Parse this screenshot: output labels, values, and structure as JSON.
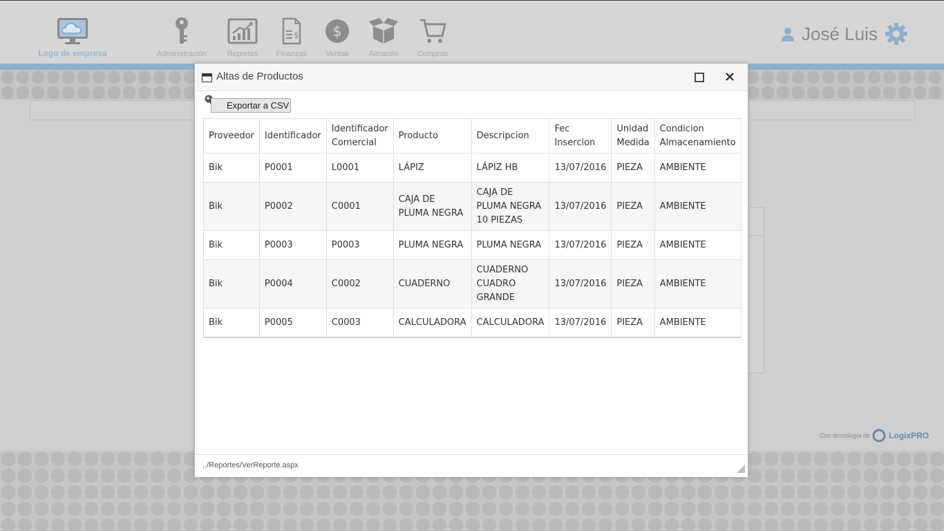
{
  "app": {
    "logo_text": "Logo de empresa",
    "nav": [
      {
        "label": "Administración",
        "icon": "key-icon"
      },
      {
        "label": "Reportes",
        "icon": "chart-icon"
      },
      {
        "label": "Finanzas",
        "icon": "finance-document-icon"
      },
      {
        "label": "Ventas",
        "icon": "dollar-icon"
      },
      {
        "label": "Almacén",
        "icon": "box-icon"
      },
      {
        "label": "Compras",
        "icon": "cart-icon"
      }
    ],
    "user_name": "José Luis",
    "powered_by": "Con tecnología de",
    "powered_brand": "LogixPRO"
  },
  "modal": {
    "title": "Altas de Productos",
    "export_label": "Exportar a CSV",
    "columns": [
      [
        "Proveedor"
      ],
      [
        "Identificador"
      ],
      [
        "Identificador",
        "Comercial"
      ],
      [
        "Producto"
      ],
      [
        "Descripcion"
      ],
      [
        "Fec",
        "Insercion"
      ],
      [
        "Unidad",
        "Medida"
      ],
      [
        "Condicion",
        "Almacenamiento"
      ]
    ],
    "rows": [
      [
        "Bik",
        "P0001",
        "L0001",
        [
          "LÁPIZ"
        ],
        [
          "LÁPIZ HB"
        ],
        "13/07/2016",
        "PIEZA",
        "AMBIENTE"
      ],
      [
        "Bik",
        "P0002",
        "C0001",
        [
          "CAJA DE",
          "PLUMA NEGRA"
        ],
        [
          "CAJA DE",
          "PLUMA NEGRA",
          "10 PIEZAS"
        ],
        "13/07/2016",
        "PIEZA",
        "AMBIENTE"
      ],
      [
        "Bik",
        "P0003",
        "P0003",
        [
          "PLUMA NEGRA"
        ],
        [
          "PLUMA NEGRA"
        ],
        "13/07/2016",
        "PIEZA",
        "AMBIENTE"
      ],
      [
        "Bik",
        "P0004",
        "C0002",
        [
          "CUADERNO"
        ],
        [
          "CUADERNO",
          "CUADRO",
          "GRANDE"
        ],
        "13/07/2016",
        "PIEZA",
        "AMBIENTE"
      ],
      [
        "Bik",
        "P0005",
        "C0003",
        [
          "CALCULADORA"
        ],
        [
          "CALCULADORA"
        ],
        "13/07/2016",
        "PIEZA",
        "AMBIENTE"
      ]
    ],
    "footer_url": "../Reportes/VerReporte.aspx"
  },
  "colors": {
    "accent_strip": "#8fb0cc",
    "logo_blue": "#9ab8d6"
  }
}
